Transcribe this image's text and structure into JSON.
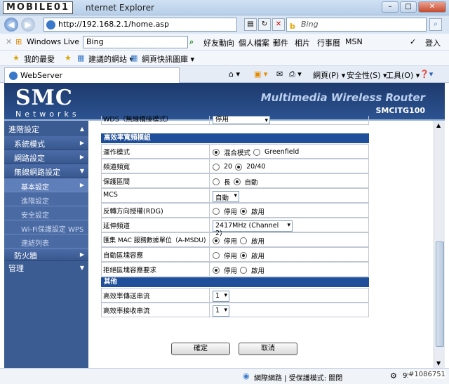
{
  "window": {
    "logo": "MOBILE01",
    "title": "nternet Explorer",
    "url": "http://192.168.2.1/home.asp",
    "search_placeholder": "Bing"
  },
  "links_bar": {
    "windows_live": "Windows Live",
    "bing_value": "Bing",
    "items": [
      "好友動向",
      "個人檔案",
      "郵件",
      "相片",
      "行事曆",
      "MSN"
    ],
    "signin": "登入"
  },
  "favorites_bar": {
    "favorites": "我的最愛",
    "suggested": "建議的網站 ▾",
    "web_slice": "網頁快訊圖庫 ▾"
  },
  "tab": {
    "title": "WebServer"
  },
  "command_bar": {
    "page": "網頁(P) ▾",
    "safety": "安全性(S) ▾",
    "tools": "工具(O) ▾"
  },
  "router": {
    "brand": "SMC",
    "brand_sub": "Networks",
    "title": "Multimedia Wireless Router",
    "model": "SMCITG100"
  },
  "sidebar": [
    {
      "label": "進階設定",
      "level": 0
    },
    {
      "label": "系統模式",
      "level": 1
    },
    {
      "label": "網路設定",
      "level": 1
    },
    {
      "label": "無線網路設定",
      "level": 1
    },
    {
      "label": "基本設定",
      "level": 2,
      "selected": true
    },
    {
      "label": "進階設定",
      "level": 2
    },
    {
      "label": "安全設定",
      "level": 2
    },
    {
      "label": "Wi-Fi保護設定 WPS",
      "level": 2
    },
    {
      "label": "連結列表",
      "level": 2
    },
    {
      "label": "防火牆",
      "level": 1
    },
    {
      "label": "管理",
      "level": 0
    }
  ],
  "partial_row": {
    "label": "WDS（無線橋接模式）",
    "value": "停用"
  },
  "sections": [
    {
      "title": "高效率寬頻模組",
      "rows": [
        {
          "label": "運作模式",
          "type": "radio",
          "options": [
            "混合模式",
            "Greenfield"
          ],
          "selected": 0
        },
        {
          "label": "頻道頻寬",
          "type": "radio",
          "options": [
            "20",
            "20/40"
          ],
          "selected": 1
        },
        {
          "label": "保護區間",
          "type": "radio",
          "options": [
            "長",
            "自動"
          ],
          "selected": 1
        },
        {
          "label": "MCS",
          "type": "select",
          "value": "自動"
        },
        {
          "label": "反轉方向授權(RDG)",
          "type": "radio",
          "options": [
            "停用",
            "啟用"
          ],
          "selected": 1
        },
        {
          "label": "延伸頻道",
          "type": "select",
          "value": "2417MHz (Channel 2)"
        },
        {
          "label": "匯集 MAC 服務數據單位（A-MSDU)",
          "type": "radio",
          "options": [
            "停用",
            "啟用"
          ],
          "selected": 0
        },
        {
          "label": "自動區塊容應",
          "type": "radio",
          "options": [
            "停用",
            "啟用"
          ],
          "selected": 1
        },
        {
          "label": "拒絕區塊容應要求",
          "type": "radio",
          "options": [
            "停用",
            "啟用"
          ],
          "selected": 0
        }
      ]
    },
    {
      "title": "其他",
      "rows": [
        {
          "label": "高效率傳送串流",
          "type": "select",
          "value": "1"
        },
        {
          "label": "高效率接收串流",
          "type": "select",
          "value": "1"
        }
      ]
    }
  ],
  "buttons": {
    "ok": "確定",
    "cancel": "取消"
  },
  "status_bar": {
    "zone": "網際網路 | 受保護模式: 關閉",
    "zoom": "95%"
  },
  "watermark": "#1086751"
}
